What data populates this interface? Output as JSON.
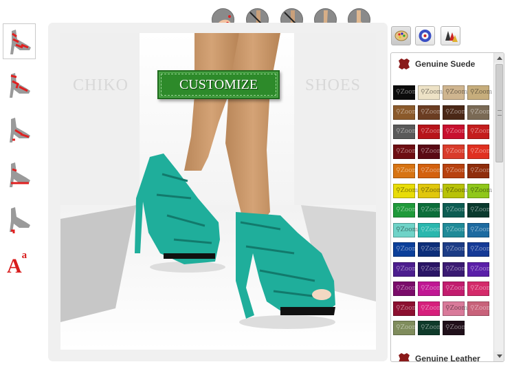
{
  "thumbnails": [
    {
      "name": "style-view-1",
      "selected": true
    },
    {
      "name": "style-view-2",
      "selected": false
    },
    {
      "name": "style-view-3",
      "selected": false
    },
    {
      "name": "style-view-4",
      "selected": false
    },
    {
      "name": "style-view-5",
      "selected": false
    }
  ],
  "text_tool": {
    "main": "A",
    "sup": "a"
  },
  "view_icons": [
    "toe-nail-icon",
    "leg-bare-icon",
    "leg-bare-alt-icon",
    "leg-side-icon",
    "foot-side-icon"
  ],
  "scene": {
    "brand_left": "CHIKO",
    "brand_right": "SHOES",
    "customize_button": "CUSTOMIZE",
    "shoe_color": "#1fae9b"
  },
  "tools": [
    "palette-icon",
    "color-wheel-icon",
    "layers-icon"
  ],
  "panel": {
    "section1_title": "Genuine Suede",
    "section2_title": "Genuine Leather",
    "zoom_label": "Zoom",
    "swatches": [
      "#0c0c0c",
      "#ede2c6",
      "#cfb58f",
      "#c6ad7c",
      "#8b5a2b",
      "#6b3d22",
      "#4b2817",
      "#7a6a55",
      "#5a5a5a",
      "#b7141a",
      "#c8102e",
      "#c41d1d",
      "#6e0e12",
      "#5a0a14",
      "#d93b2b",
      "#e03020",
      "#d77412",
      "#d3610e",
      "#b8420f",
      "#8f2d0b",
      "#e8dc08",
      "#e0c70c",
      "#b8c208",
      "#8fc71a",
      "#1f9a3a",
      "#0c6e3a",
      "#0d5c52",
      "#0a3a2e",
      "#6fd3c8",
      "#2ab7ae",
      "#1f8a98",
      "#1d6aa0",
      "#0b3f9a",
      "#0d2f7a",
      "#1c3c86",
      "#153a96",
      "#4c1d8e",
      "#2a1565",
      "#3a1a72",
      "#5a1fa8",
      "#7a0c6a",
      "#c01793",
      "#c21c6e",
      "#d42a6a",
      "#8c1030",
      "#d6207c",
      "#d97a9a",
      "#c8627a",
      "#7f8c5c",
      "#0f3a2a",
      "#20101a"
    ]
  }
}
